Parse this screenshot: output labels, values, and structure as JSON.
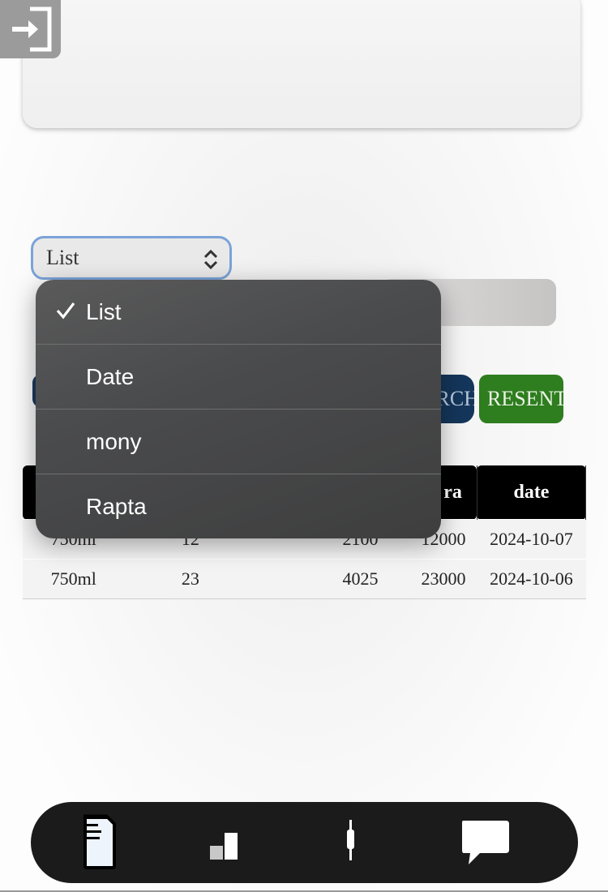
{
  "select": {
    "value": "List",
    "options": [
      "List",
      "Date",
      "mony",
      "Rapta"
    ],
    "selected_index": 0
  },
  "buttons": {
    "search_label": "SEARCH",
    "reset_label": "RESENT"
  },
  "table": {
    "headers": [
      "",
      "",
      "",
      "ra",
      "date"
    ],
    "rows": [
      [
        "750ml",
        "12",
        "2100",
        "12000",
        "2024-10-07"
      ],
      [
        "750ml",
        "23",
        "4025",
        "23000",
        "2024-10-06"
      ]
    ]
  },
  "colors": {
    "select_border": "#7ba3d8",
    "search_bg": "#14365a",
    "reset_bg": "#2e7d1f",
    "tabbar_bg": "#1b1b1b"
  },
  "icons": {
    "login": "login-icon",
    "chevron": "chevron-up-down-icon",
    "check": "checkmark-icon",
    "tabs": [
      "document-icon",
      "bar-chart-icon",
      "pen-icon",
      "chat-bubble-icon"
    ]
  }
}
